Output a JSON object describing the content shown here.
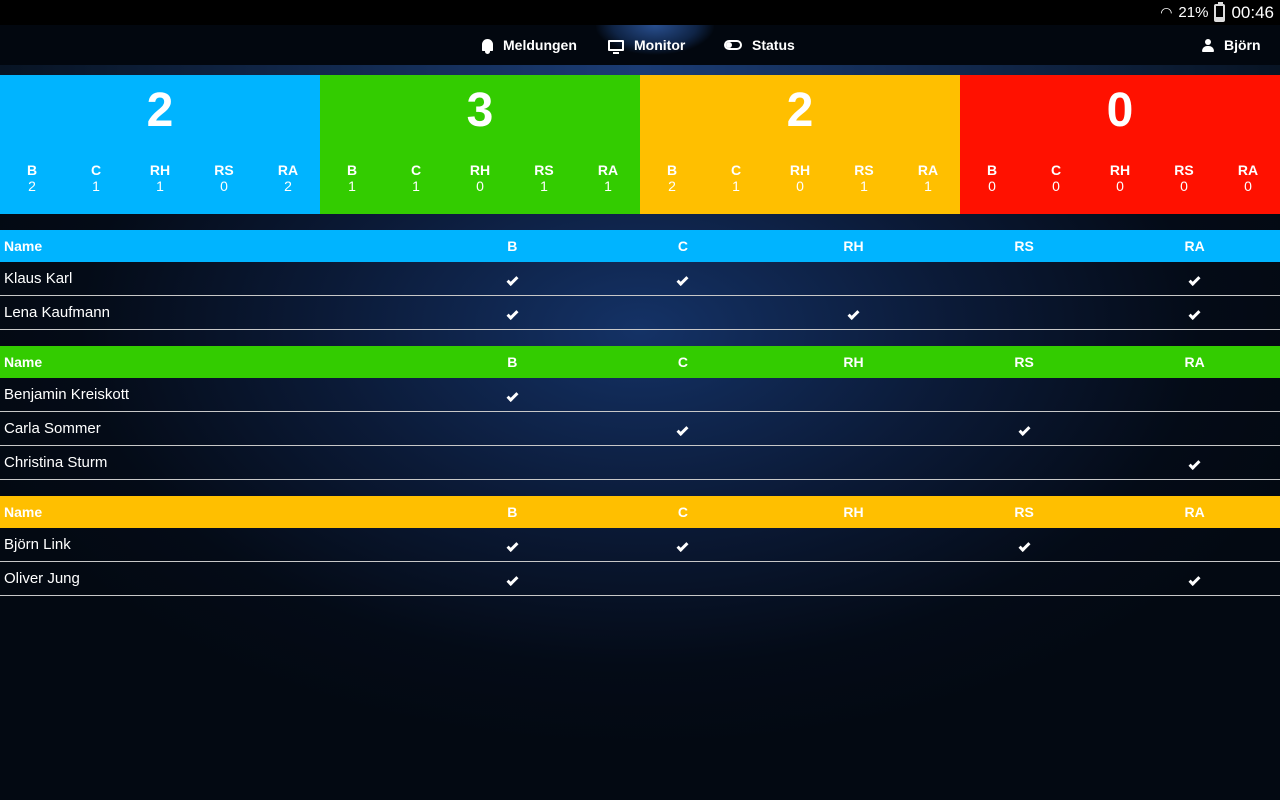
{
  "status_bar": {
    "battery": "21%",
    "time": "00:46"
  },
  "nav": {
    "items": [
      {
        "label": "Meldungen",
        "icon": "bell-icon"
      },
      {
        "label": "Monitor",
        "icon": "monitor-icon",
        "active": true
      },
      {
        "label": "Status",
        "icon": "toggle-icon"
      }
    ],
    "user": {
      "label": "Björn",
      "icon": "user-icon"
    }
  },
  "colors": {
    "blue": "#00b4ff",
    "green": "#33cc00",
    "yellow": "#ffbf00",
    "red": "#ff1100"
  },
  "summary": [
    {
      "color": "#00b4ff",
      "total": "2",
      "stats": [
        {
          "label": "B",
          "value": "2"
        },
        {
          "label": "C",
          "value": "1"
        },
        {
          "label": "RH",
          "value": "1"
        },
        {
          "label": "RS",
          "value": "0"
        },
        {
          "label": "RA",
          "value": "2"
        }
      ]
    },
    {
      "color": "#33cc00",
      "total": "3",
      "stats": [
        {
          "label": "B",
          "value": "1"
        },
        {
          "label": "C",
          "value": "1"
        },
        {
          "label": "RH",
          "value": "0"
        },
        {
          "label": "RS",
          "value": "1"
        },
        {
          "label": "RA",
          "value": "1"
        }
      ]
    },
    {
      "color": "#ffbf00",
      "total": "2",
      "stats": [
        {
          "label": "B",
          "value": "2"
        },
        {
          "label": "C",
          "value": "1"
        },
        {
          "label": "RH",
          "value": "0"
        },
        {
          "label": "RS",
          "value": "1"
        },
        {
          "label": "RA",
          "value": "1"
        }
      ]
    },
    {
      "color": "#ff1100",
      "total": "0",
      "stats": [
        {
          "label": "B",
          "value": "0"
        },
        {
          "label": "C",
          "value": "0"
        },
        {
          "label": "RH",
          "value": "0"
        },
        {
          "label": "RS",
          "value": "0"
        },
        {
          "label": "RA",
          "value": "0"
        }
      ]
    }
  ],
  "table_headers": [
    "Name",
    "B",
    "C",
    "RH",
    "RS",
    "RA"
  ],
  "groups": [
    {
      "color": "#00b4ff",
      "rows": [
        {
          "name": "Klaus Karl",
          "checks": [
            true,
            true,
            false,
            false,
            true
          ]
        },
        {
          "name": "Lena Kaufmann",
          "checks": [
            true,
            false,
            true,
            false,
            true
          ]
        }
      ]
    },
    {
      "color": "#33cc00",
      "rows": [
        {
          "name": "Benjamin Kreiskott",
          "checks": [
            true,
            false,
            false,
            false,
            false
          ]
        },
        {
          "name": "Carla Sommer",
          "checks": [
            false,
            true,
            false,
            true,
            false
          ]
        },
        {
          "name": "Christina Sturm",
          "checks": [
            false,
            false,
            false,
            false,
            true
          ]
        }
      ]
    },
    {
      "color": "#ffbf00",
      "rows": [
        {
          "name": "Björn Link",
          "checks": [
            true,
            true,
            false,
            true,
            false
          ]
        },
        {
          "name": "Oliver Jung",
          "checks": [
            true,
            false,
            false,
            false,
            true
          ]
        }
      ]
    }
  ]
}
